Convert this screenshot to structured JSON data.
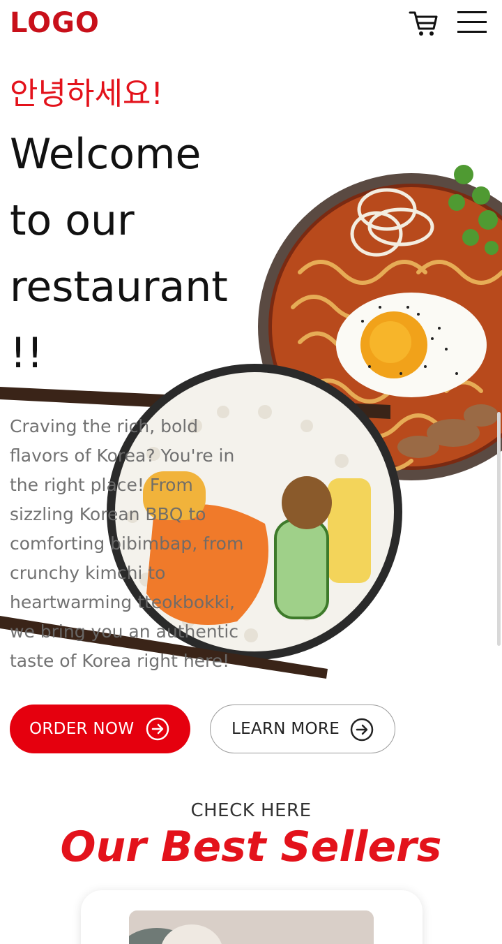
{
  "header": {
    "logo": "LOGO",
    "cart_icon": "cart-icon",
    "menu_icon": "hamburger-menu-icon"
  },
  "hero": {
    "greeting": "안녕하세요!",
    "headline_lines": [
      "Welcome",
      "to our",
      "restaurant",
      "!!"
    ],
    "intro": "Craving the rich, bold flavors of Korea? You're in the right place! From sizzling Korean BBQ to comforting bibimbap, from crunchy kimchi to heartwarming tteokbokki, we bring you an authentic taste of Korea right here!",
    "images": [
      "ramen-bowl-image",
      "kimbap-chopsticks-image"
    ]
  },
  "actions": {
    "order_label": "ORDER NOW",
    "learn_label": "LEARN MORE",
    "arrow_icon": "arrow-right-circle-icon"
  },
  "best_sellers": {
    "eyebrow": "CHECK HERE",
    "title": "Our Best Sellers"
  },
  "colors": {
    "brand_red": "#e3121b",
    "logo_red": "#c8101a",
    "button_red": "#e5000e"
  }
}
